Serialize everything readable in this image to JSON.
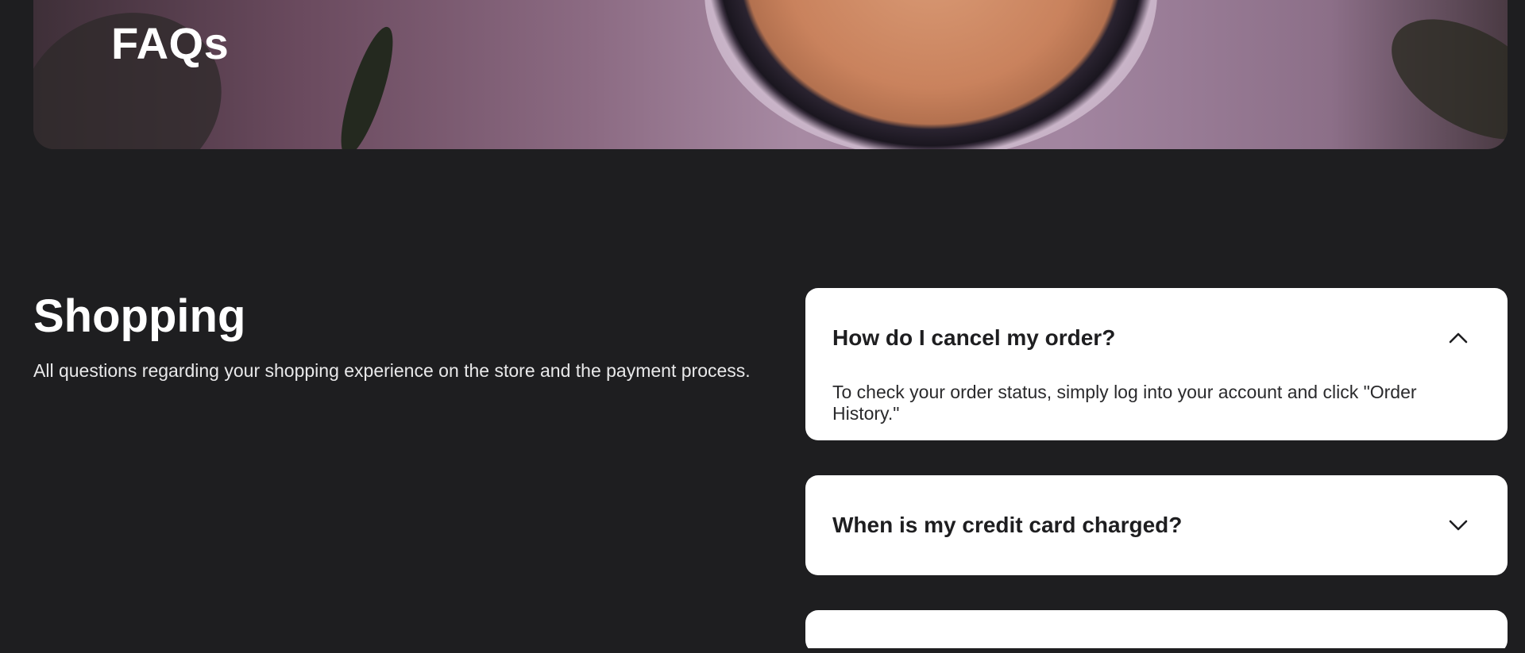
{
  "hero": {
    "title": "FAQs"
  },
  "section": {
    "title": "Shopping",
    "description": "All questions regarding your shopping experience on the store and the payment process."
  },
  "faq": [
    {
      "question": "How do I cancel my order?",
      "answer": "To check your order status, simply log into your account and click \"Order History.\"",
      "expanded": true,
      "icon": "chevron-up-icon"
    },
    {
      "question": "When is my credit card charged?",
      "expanded": false,
      "icon": "chevron-down-icon"
    }
  ],
  "colors": {
    "background": "#1e1e20",
    "card": "#ffffff",
    "text_dark": "#1e1e20",
    "text_light": "#ffffff"
  }
}
